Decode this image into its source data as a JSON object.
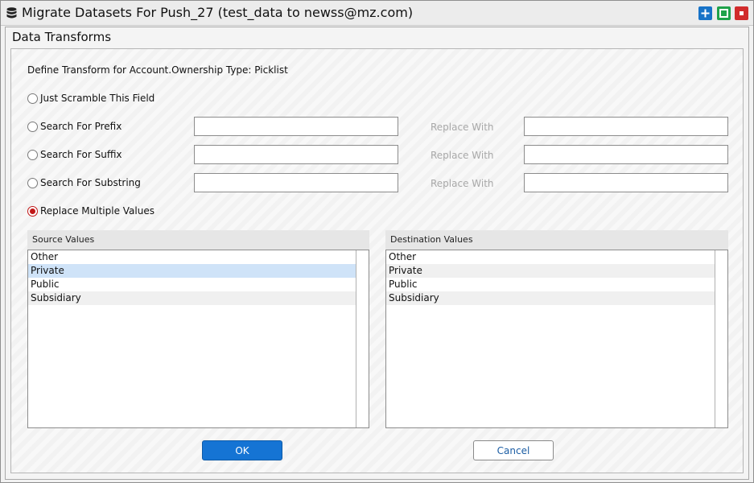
{
  "window": {
    "title": "Migrate Datasets For Push_27 (test_data to newss@mz.com)",
    "icon": "database-icon",
    "controls": {
      "maximize": "plus-icon",
      "restore": "square-icon",
      "close": "stop-icon"
    },
    "colors": {
      "maximize": "#1773c8",
      "restore": "#1fa24a",
      "close": "#d12b2b"
    }
  },
  "panel": {
    "title": "Data Transforms",
    "define_label": "Define Transform for Account.Ownership Type: Picklist"
  },
  "options": [
    {
      "label": "Just Scramble This Field",
      "checked": false
    },
    {
      "label": "Search For Prefix",
      "checked": false,
      "search_value": "",
      "replace_label": "Replace With",
      "replace_value": ""
    },
    {
      "label": "Search For Suffix",
      "checked": false,
      "search_value": "",
      "replace_label": "Replace With",
      "replace_value": ""
    },
    {
      "label": "Search For Substring",
      "checked": false,
      "search_value": "",
      "replace_label": "Replace With",
      "replace_value": ""
    },
    {
      "label": "Replace Multiple Values",
      "checked": true
    }
  ],
  "source_values": {
    "header": "Source Values",
    "items": [
      "Other",
      "Private",
      "Public",
      "Subsidiary"
    ],
    "selected": "Private"
  },
  "destination_values": {
    "header": "Destination Values",
    "items": [
      "Other",
      "Private",
      "Public",
      "Subsidiary"
    ]
  },
  "buttons": {
    "ok": "OK",
    "cancel": "Cancel"
  },
  "accent_color": "#1574d4"
}
